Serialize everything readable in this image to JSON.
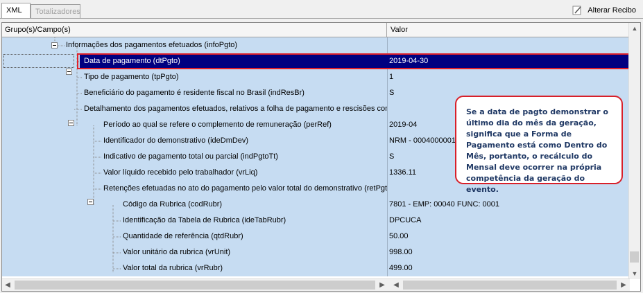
{
  "tabs": [
    {
      "label": "XML",
      "active": true
    },
    {
      "label": "Totalizadores",
      "active": false
    }
  ],
  "toolbar": {
    "alter_label": "Alterar Recibo",
    "alter_icon": "edit-icon"
  },
  "grid": {
    "col_headers": [
      "Grupo(s)/Campo(s)",
      "Valor"
    ],
    "rows": [
      {
        "name": "Informações dos pagamentos efetuados (infoPgto)",
        "value": "",
        "expander": true
      },
      {
        "name": "Data de pagamento (dtPgto)",
        "value": "2019-04-30",
        "selected": true
      },
      {
        "name": "Tipo de pagamento (tpPgto)",
        "value": "1"
      },
      {
        "name": "Beneficiário do pagamento é residente fiscal no Brasil (indResBr)",
        "value": "S"
      },
      {
        "name": "Detalhamento dos pagamentos efetuados, relativos a folha de pagamento e rescisões contr",
        "value": "",
        "expander": true
      },
      {
        "name": "Período ao qual se refere o complemento de remuneração (perRef)",
        "value": "2019-04"
      },
      {
        "name": "Identificador do demonstrativo (ideDmDev)",
        "value": "NRM - 0004000001"
      },
      {
        "name": "Indicativo de pagamento total ou parcial (indPgtoTt)",
        "value": "S"
      },
      {
        "name": "Valor líquido recebido pelo trabalhador (vrLiq)",
        "value": "1336.11"
      },
      {
        "name": "Retenções efetuadas no ato do pagamento pelo valor total do demonstrativo (retPgtoT",
        "value": "",
        "expander": true
      },
      {
        "name": "Código da Rubrica (codRubr)",
        "value": "7801 - EMP: 00040 FUNC: 0001"
      },
      {
        "name": "Identificação da Tabela de Rubrica (ideTabRubr)",
        "value": "DPCUCA"
      },
      {
        "name": "Quantidade de referência (qtdRubr)",
        "value": "50.00"
      },
      {
        "name": "Valor unitário da rubrica (vrUnit)",
        "value": "998.00"
      },
      {
        "name": "Valor total da rubrica (vrRubr)",
        "value": "499.00"
      }
    ]
  },
  "callout": {
    "text": "Se a data de pagto demonstrar o último dia do mês da geração, significa que a Forma de Pagamento está como Dentro do Mês, portanto, o recálculo do Mensal deve ocorrer na própria competência da geração do evento."
  },
  "colors": {
    "selection": "#000080",
    "grid_bg": "#c6dcf2",
    "callout_border": "#d8202a",
    "callout_text": "#1f3864"
  }
}
